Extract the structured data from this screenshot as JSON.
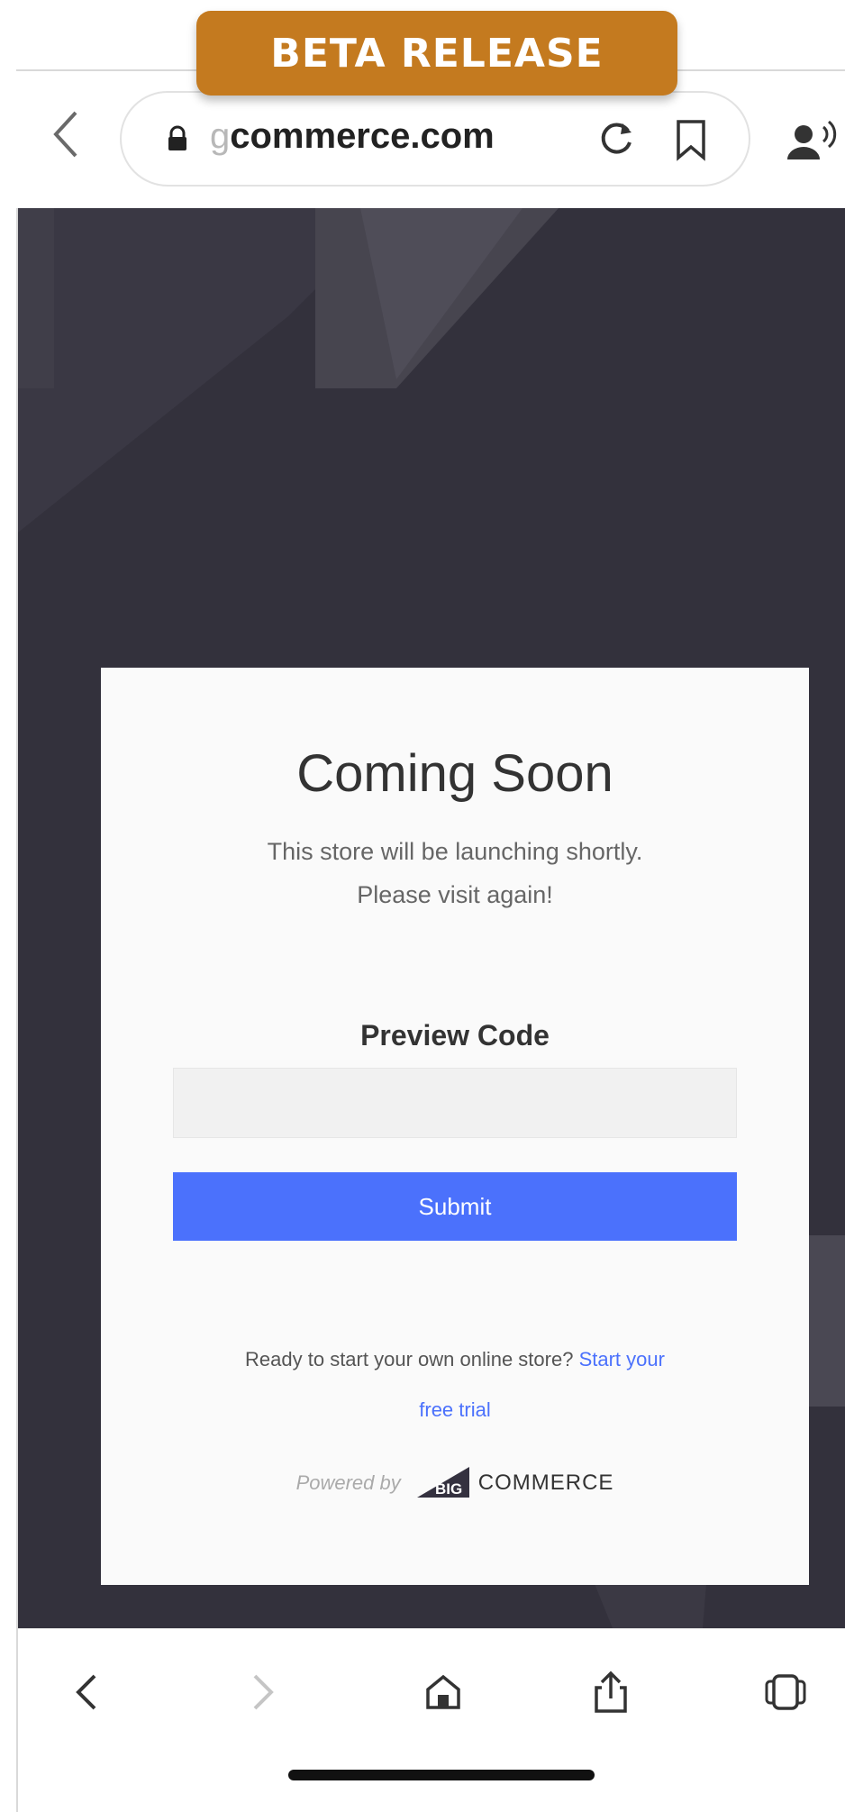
{
  "badge": {
    "label": "BETA RELEASE",
    "color": "#c47a1f"
  },
  "browser": {
    "url_dim_prefix": "g",
    "url_main": "commerce.com",
    "icons": [
      "back-icon",
      "lock-icon",
      "reload-icon",
      "bookmark-icon",
      "reader-voice-icon"
    ]
  },
  "page": {
    "title": "Coming Soon",
    "subtitle_line1": "This store will be launching shortly.",
    "subtitle_line2": "Please visit again!",
    "preview_label": "Preview Code",
    "preview_input_value": "",
    "submit_label": "Submit",
    "ready_prefix": "Ready to start your own online store?",
    "ready_link_1": "Start your",
    "ready_link_2": "free trial",
    "powered_by": "Powered by",
    "logo_big": "BIG",
    "logo_commerce": "COMMERCE",
    "accent_color": "#4b71fc",
    "background_color": "#33313c"
  },
  "toolbar": {
    "icons": [
      "back-arrow-icon",
      "forward-arrow-icon",
      "home-icon",
      "share-icon",
      "tabs-icon"
    ]
  }
}
